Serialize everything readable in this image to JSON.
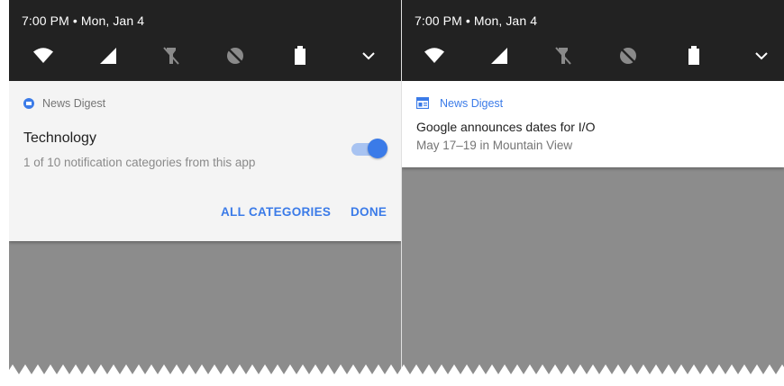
{
  "left": {
    "status_time": "7:00 PM • Mon, Jan 4",
    "quick_settings": [
      "wifi-icon",
      "cell-signal-icon",
      "flashlight-off-icon",
      "do-not-disturb-icon",
      "battery-icon",
      "chevron-down-icon"
    ],
    "notification": {
      "app_name": "News Digest",
      "category_title": "Technology",
      "category_subtitle": "1 of 10 notification categories from this app",
      "toggle_on": true,
      "actions": {
        "all_categories": "ALL CATEGORIES",
        "done": "DONE"
      }
    }
  },
  "right": {
    "status_time": "7:00 PM • Mon, Jan 4",
    "quick_settings": [
      "wifi-icon",
      "cell-signal-icon",
      "flashlight-off-icon",
      "do-not-disturb-icon",
      "battery-icon",
      "chevron-down-icon"
    ],
    "notification": {
      "app_name": "News Digest",
      "headline": "Google announces dates for I/O",
      "detail": "May 17–19 in Mountain View"
    }
  },
  "colors": {
    "shade": "#222222",
    "accent": "#3b7be8",
    "scrim": "#8c8c8c"
  }
}
